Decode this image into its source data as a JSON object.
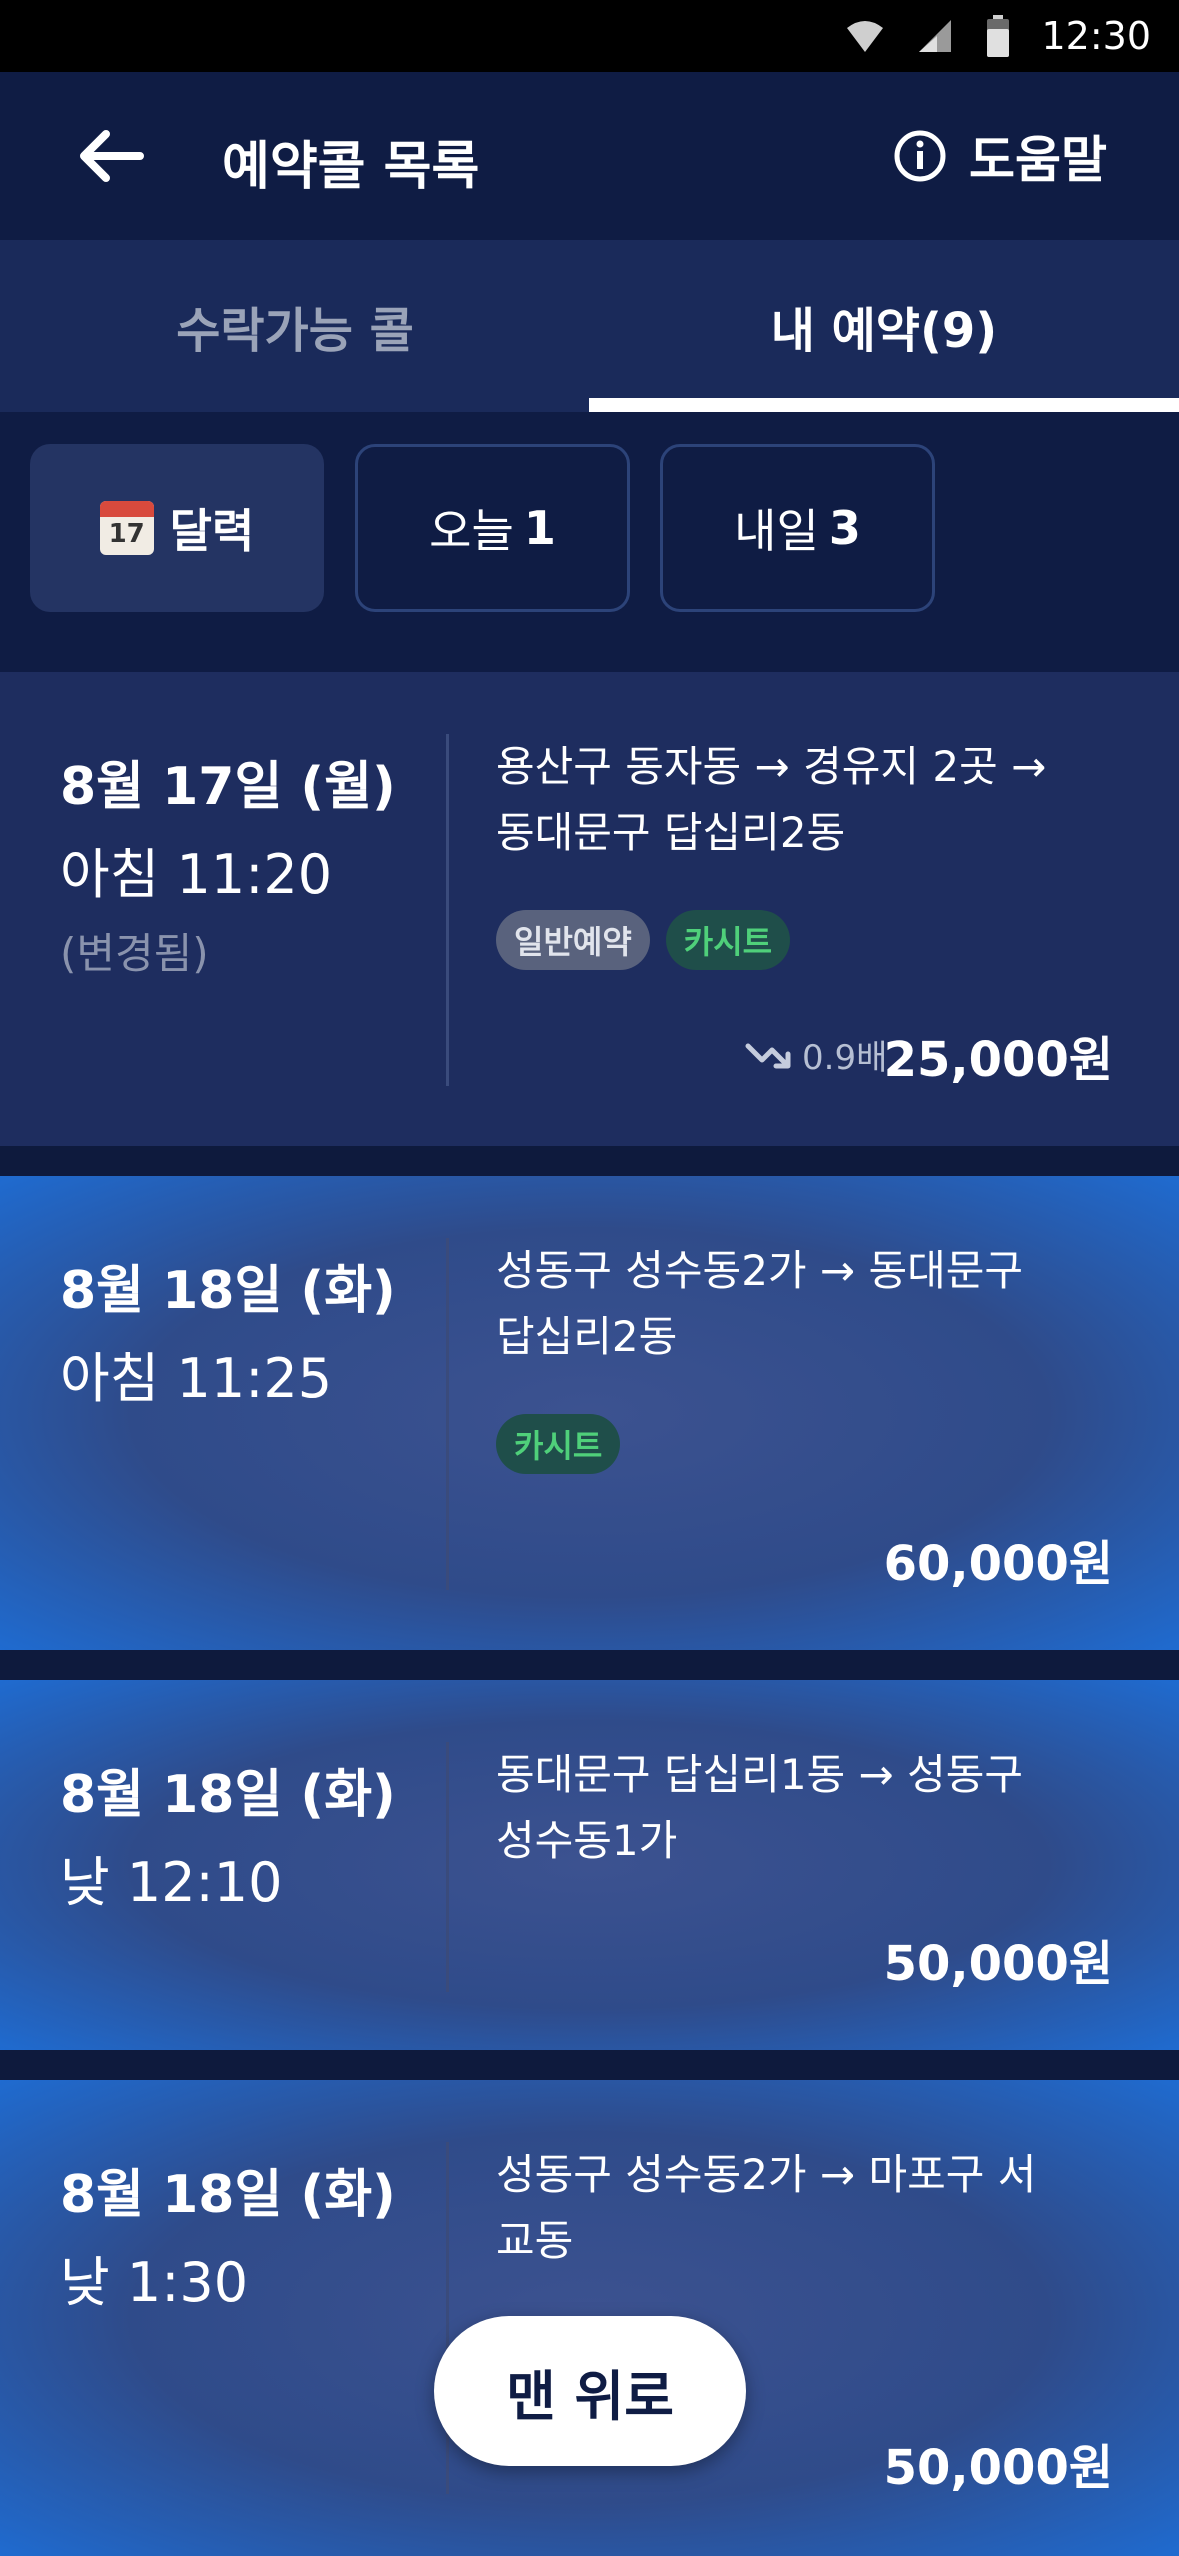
{
  "status_bar": {
    "time": "12:30"
  },
  "header": {
    "title": "예약콜 목록",
    "help_label": "도움말"
  },
  "tabs": [
    {
      "label": "수락가능 콜",
      "active": false
    },
    {
      "label": "내 예약(9)",
      "active": true
    }
  ],
  "filters": {
    "calendar_label": "달력",
    "calendar_icon_day": "17",
    "today_label": "오늘",
    "today_count": "1",
    "tomorrow_label": "내일",
    "tomorrow_count": "3"
  },
  "bookings": [
    {
      "date": "8월 17일 (월)",
      "time": "아침 11:20",
      "note": "(변경됨)",
      "route_line1": "용산구 동자동  →  경유지 2곳  →",
      "route_line2": "동대문구 답십리2동",
      "tags": [
        "일반예약",
        "카시트"
      ],
      "multiplier": "0.9배",
      "price": "25,000원"
    },
    {
      "date": "8월 18일 (화)",
      "time": "아침 11:25",
      "route_line1": "성동구 성수동2가  →  동대문구",
      "route_line2": "답십리2동",
      "tags": [
        "카시트"
      ],
      "price": "60,000원"
    },
    {
      "date": "8월 18일 (화)",
      "time": "낮 12:10",
      "route_line1": "동대문구 답십리1동  →  성동구",
      "route_line2": "성수동1가",
      "price": "50,000원"
    },
    {
      "date": "8월 18일 (화)",
      "time": "낮 1:30",
      "route_line1": "성동구 성수동2가  →  마포구 서",
      "route_line2": "교동",
      "price": "50,000원"
    }
  ],
  "scroll_top_label": "맨 위로",
  "colors": {
    "background": "#0e1a3d",
    "accent_green": "#4fd07a",
    "tab_indicator": "#ffffff"
  }
}
